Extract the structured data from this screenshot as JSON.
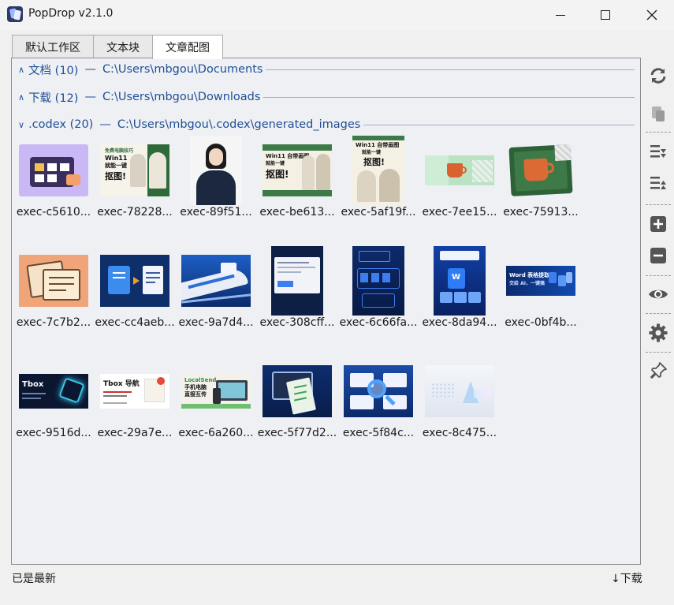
{
  "window": {
    "title": "PopDrop v2.1.0",
    "icon": "app-icon"
  },
  "tabs": [
    {
      "label": "默认工作区",
      "active": false
    },
    {
      "label": "文本块",
      "active": false
    },
    {
      "label": "文章配图",
      "active": true
    }
  ],
  "groups": [
    {
      "chevron": "∧",
      "name": "文档 (10)",
      "separator": "—",
      "path": "C:\\Users\\mbgou\\Documents",
      "expanded": false
    },
    {
      "chevron": "∧",
      "name": "下载 (12)",
      "separator": "—",
      "path": "C:\\Users\\mbgou\\Downloads",
      "expanded": false
    },
    {
      "chevron": "∨",
      "name": ".codex (20)",
      "separator": "—",
      "path": "C:\\Users\\mbgou\\.codex\\generated_images",
      "expanded": true
    }
  ],
  "images": [
    {
      "name": "exec-c5610...",
      "art": "purple-folder"
    },
    {
      "name": "exec-78228...",
      "art": "win11-portrait-small"
    },
    {
      "name": "exec-89f51...",
      "art": "portrait-woman"
    },
    {
      "name": "exec-be613...",
      "art": "win11-banner"
    },
    {
      "name": "exec-5af19f...",
      "art": "win11-poster"
    },
    {
      "name": "exec-7ee15...",
      "art": "mug-green-banner"
    },
    {
      "name": "exec-75913...",
      "art": "mug-card"
    },
    {
      "name": "exec-7c7b2...",
      "art": "orange-docs"
    },
    {
      "name": "exec-cc4aeb...",
      "art": "doc-convert"
    },
    {
      "name": "exec-9a7d4...",
      "art": "bullet-train"
    },
    {
      "name": "exec-308cff...",
      "art": "dark-web-page"
    },
    {
      "name": "exec-6c66fa...",
      "art": "word-poster"
    },
    {
      "name": "exec-8da94...",
      "art": "word-stack"
    },
    {
      "name": "exec-0bf4b...",
      "art": "word-banner",
      "text": [
        "Word 表格提取",
        "交给 AI，一键搞"
      ]
    },
    {
      "name": "exec-9516d...",
      "art": "tbox-dark",
      "text": [
        "Tbox"
      ]
    },
    {
      "name": "exec-29a7e...",
      "art": "tbox-white",
      "text": [
        "Tbox 导航"
      ]
    },
    {
      "name": "exec-6a260...",
      "art": "localsend",
      "text": [
        "LocalSend",
        "手机电脑",
        "直接互传"
      ]
    },
    {
      "name": "exec-5f77d2...",
      "art": "monitor-list"
    },
    {
      "name": "exec-5f84c...",
      "art": "magnifier-cards"
    },
    {
      "name": "exec-8c475...",
      "art": "glass-crystal"
    }
  ],
  "thumb_text": {
    "win11": "Win11",
    "win11_headline": "Win11 自带画图",
    "win11_sub": "就能一键",
    "cutout": "抠图!",
    "mini_tag": "免费电脑技巧"
  },
  "toolbar": [
    {
      "name": "refresh-icon"
    },
    {
      "name": "paste-icon"
    },
    {
      "name": "sort-desc-icon"
    },
    {
      "name": "sort-asc-icon"
    },
    {
      "name": "add-icon"
    },
    {
      "name": "remove-icon"
    },
    {
      "name": "eye-icon"
    },
    {
      "name": "gear-icon"
    },
    {
      "name": "pin-icon"
    }
  ],
  "status": {
    "left": "已是最新",
    "right": "↓下载"
  },
  "colors": {
    "group_header": "#1f4e96",
    "panel_bg": "#eef0f4",
    "toolbar_icon": "#555555"
  }
}
